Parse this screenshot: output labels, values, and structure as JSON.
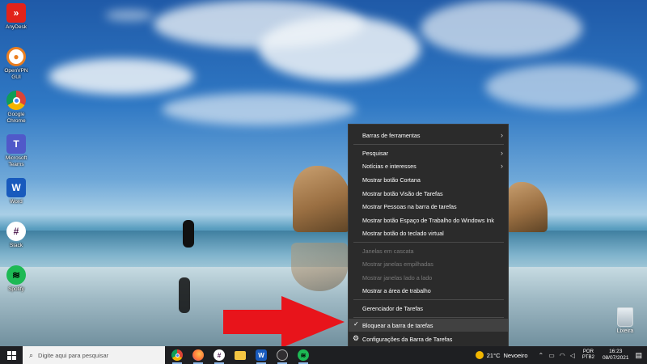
{
  "desktop_icons": [
    {
      "label": "AnyDesk",
      "icon": "anydesk-icon",
      "color": "#e2231a"
    },
    {
      "label": "OpenVPN GUI",
      "icon": "openvpn-icon",
      "color": "#ea7e20"
    },
    {
      "label": "Google Chrome",
      "icon": "chrome-icon",
      "color": "#ffffff"
    },
    {
      "label": "Microsoft Teams",
      "icon": "teams-icon",
      "color": "#5059c9"
    },
    {
      "label": "Word",
      "icon": "word-icon",
      "color": "#185abd"
    },
    {
      "label": "Slack",
      "icon": "slack-icon",
      "color": "#ffffff"
    },
    {
      "label": "Spotify",
      "icon": "spotify-icon",
      "color": "#1db954"
    }
  ],
  "recycle_bin": {
    "label": "Lixeira",
    "icon": "recycle-bin-icon"
  },
  "context_menu": {
    "items": [
      {
        "label": "Barras de ferramentas",
        "submenu": true,
        "disabled": false
      },
      {
        "label": "Pesquisar",
        "submenu": true,
        "disabled": false
      },
      {
        "label": "Notícias e interesses",
        "submenu": true,
        "disabled": false
      },
      {
        "label": "Mostrar botão Cortana",
        "disabled": false
      },
      {
        "label": "Mostrar botão Visão de Tarefas",
        "disabled": false
      },
      {
        "label": "Mostrar Pessoas na barra de tarefas",
        "disabled": false
      },
      {
        "label": "Mostrar botão Espaço de Trabalho do Windows Ink",
        "disabled": false
      },
      {
        "label": "Mostrar botão do teclado virtual",
        "disabled": false
      },
      {
        "label": "Janelas em cascata",
        "disabled": true
      },
      {
        "label": "Mostrar janelas empilhadas",
        "disabled": true
      },
      {
        "label": "Mostrar janelas lado a lado",
        "disabled": true
      },
      {
        "label": "Mostrar a área de trabalho",
        "disabled": false
      },
      {
        "label": "Gerenciador de Tarefas",
        "disabled": false
      },
      {
        "label": "Bloquear a barra de tarefas",
        "checked": true,
        "disabled": false
      },
      {
        "label": "Configurações da Barra de Tarefas",
        "icon": "gear-icon",
        "disabled": false
      }
    ]
  },
  "taskbar": {
    "search_placeholder": "Digite aqui para pesquisar",
    "pinned_apps": [
      "chrome-icon",
      "firefox-icon",
      "slack-icon",
      "file-explorer-icon",
      "word-icon",
      "obs-icon",
      "spotify-icon"
    ],
    "weather": {
      "temp": "21°C",
      "condition": "Nevoeiro"
    },
    "language": {
      "line1": "POR",
      "line2": "PTB2"
    },
    "clock": {
      "time": "16:23",
      "date": "08/07/2021"
    }
  },
  "colors": {
    "menu_bg": "#2b2b2b",
    "taskbar_bg": "#1e1f22",
    "arrow": "#e8141b"
  }
}
